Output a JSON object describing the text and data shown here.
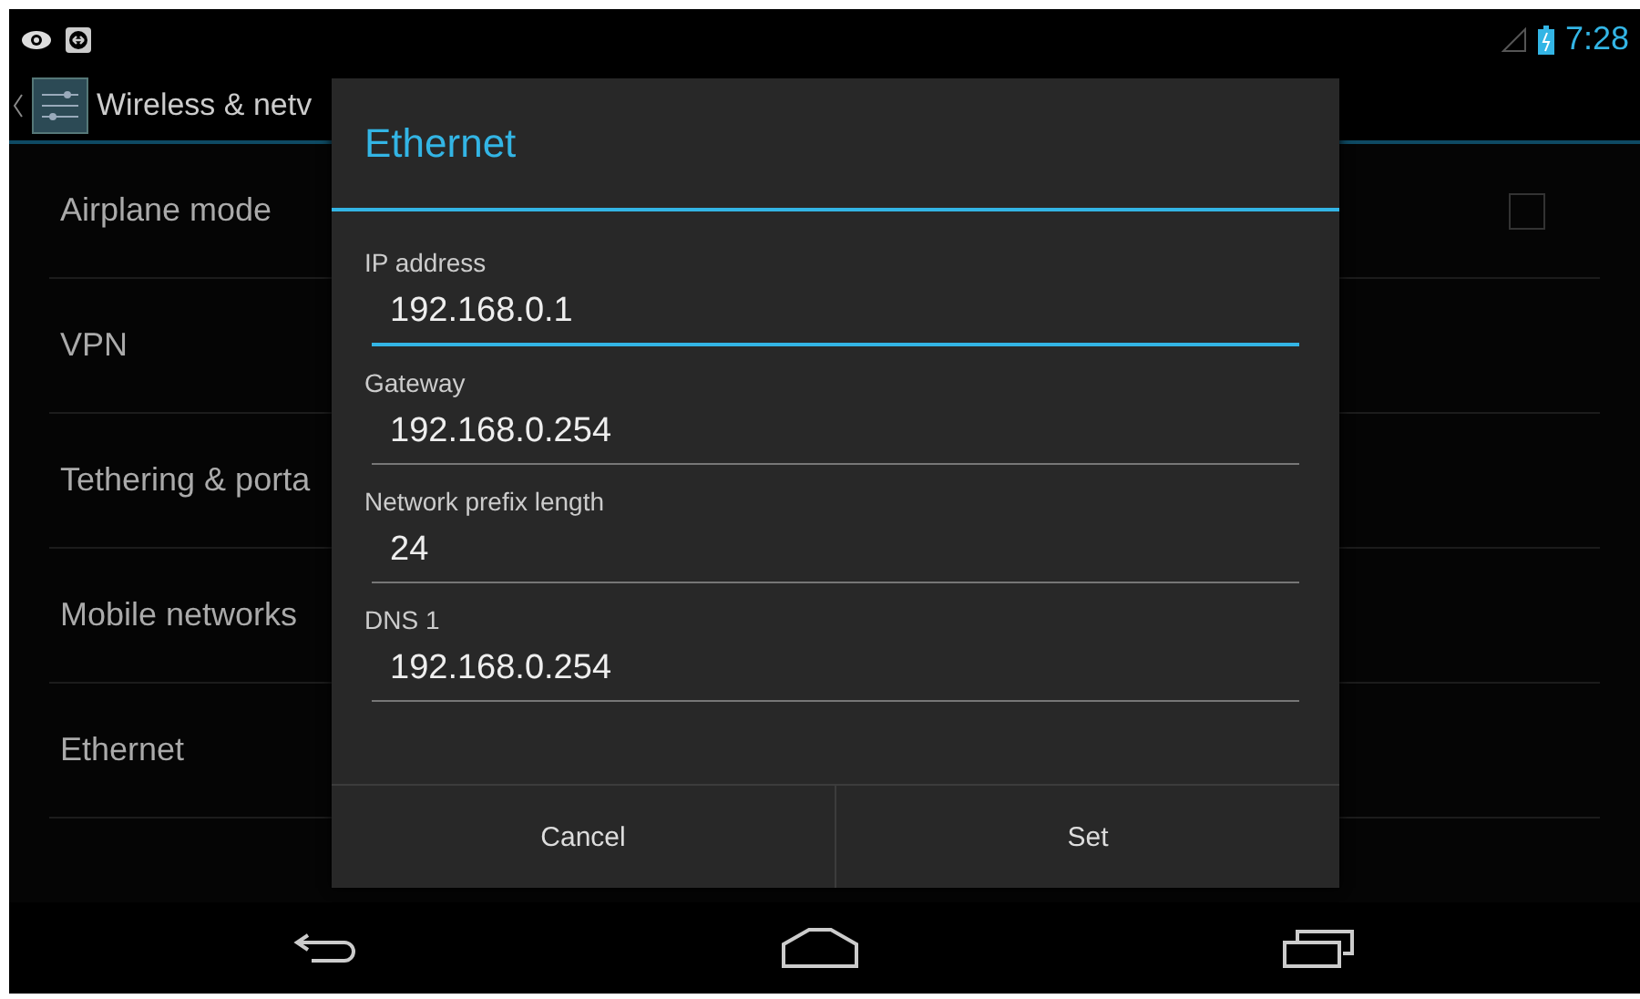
{
  "status_bar": {
    "time": "7:28"
  },
  "action_bar": {
    "title": "Wireless & netv"
  },
  "settings": [
    {
      "label": "Airplane mode",
      "kind": "checkbox",
      "checked": false
    },
    {
      "label": "VPN",
      "kind": "plain"
    },
    {
      "label": "Tethering & porta",
      "kind": "plain"
    },
    {
      "label": "Mobile networks",
      "kind": "plain"
    },
    {
      "label": "Ethernet",
      "kind": "plain"
    }
  ],
  "dialog": {
    "title": "Ethernet",
    "fields": [
      {
        "label": "IP address",
        "value": "192.168.0.1",
        "focused": true
      },
      {
        "label": "Gateway",
        "value": "192.168.0.254",
        "focused": false
      },
      {
        "label": "Network prefix length",
        "value": "24",
        "focused": false
      },
      {
        "label": "DNS 1",
        "value": "192.168.0.254",
        "focused": false
      }
    ],
    "buttons": [
      "Cancel",
      "Set"
    ]
  }
}
